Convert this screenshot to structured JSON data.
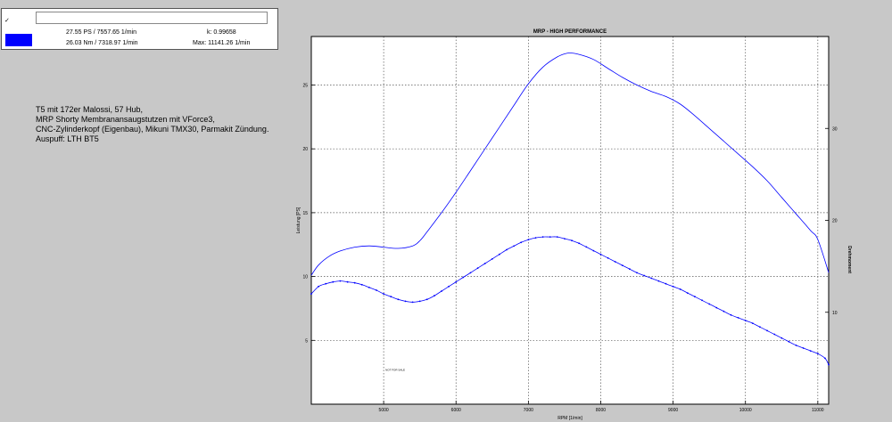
{
  "legend": {
    "checkbox_label": "✓",
    "color": "#0000ff",
    "row1_value": "27.55 PS / 7557.65 1/min",
    "row1_k": "k: 0.99658",
    "row2_value": "26.03 Nm / 7318.97 1/min",
    "row2_max": "Max: 11141.26 1/min"
  },
  "notes": {
    "lines": [
      "T5 mit 172er Malossi, 57 Hub,",
      "MRP Shorty Membranansaugstutzen mit VForce3,",
      "CNC-Zylinderkopf (Eigenbau), Mikuni TMX30, Parmakit Zündung.",
      "Auspuff: LTH BT5"
    ]
  },
  "chart_data": {
    "type": "line",
    "title": "MRP - HIGH PERFORMANCE",
    "xlabel": "RPM [1/min]",
    "ylabel": "Leistung [PS]",
    "y2label": "Drehmoment",
    "watermark": "NOT FOR SALE",
    "xlim": [
      4000,
      11150
    ],
    "ylim": [
      0,
      28.8
    ],
    "y2lim": [
      0,
      40
    ],
    "x_ticks": [
      5000,
      6000,
      7000,
      8000,
      9000,
      10000,
      11000
    ],
    "y_ticks": [
      5,
      10,
      15,
      20,
      25
    ],
    "y2_ticks": [
      10,
      20,
      30
    ],
    "grid": true,
    "line_color": "#0000ff",
    "series": [
      {
        "axis": "left",
        "markers": false,
        "x": [
          4000,
          4100,
          4250,
          4400,
          4600,
          4800,
          5000,
          5200,
          5400,
          5500,
          5600,
          5800,
          6000,
          6200,
          6400,
          6600,
          6800,
          7000,
          7200,
          7400,
          7550,
          7700,
          7900,
          8100,
          8300,
          8500,
          8700,
          8900,
          9100,
          9300,
          9500,
          9700,
          9900,
          10100,
          10300,
          10500,
          10700,
          10900,
          11000,
          11150
        ],
        "y": [
          10.1,
          10.9,
          11.6,
          12.0,
          12.3,
          12.4,
          12.3,
          12.2,
          12.4,
          12.8,
          13.5,
          15.0,
          16.6,
          18.3,
          20.0,
          21.7,
          23.4,
          25.1,
          26.4,
          27.2,
          27.5,
          27.4,
          27.0,
          26.3,
          25.6,
          25.0,
          24.5,
          24.1,
          23.5,
          22.6,
          21.6,
          20.6,
          19.6,
          18.6,
          17.5,
          16.2,
          14.9,
          13.6,
          12.9,
          10.3
        ]
      },
      {
        "axis": "right",
        "markers": true,
        "x": [
          4000,
          4100,
          4200,
          4300,
          4400,
          4500,
          4600,
          4700,
          4800,
          4900,
          5000,
          5100,
          5200,
          5300,
          5400,
          5500,
          5600,
          5700,
          5800,
          5900,
          6000,
          6100,
          6200,
          6300,
          6400,
          6500,
          6600,
          6700,
          6800,
          6900,
          7000,
          7100,
          7200,
          7300,
          7400,
          7500,
          7600,
          7700,
          7800,
          7900,
          8000,
          8100,
          8200,
          8300,
          8400,
          8500,
          8600,
          8700,
          8800,
          8900,
          9000,
          9100,
          9200,
          9300,
          9400,
          9500,
          9600,
          9700,
          9800,
          9900,
          10000,
          10100,
          10200,
          10300,
          10400,
          10500,
          10600,
          10700,
          10800,
          10900,
          11000,
          11100,
          11150
        ],
        "y": [
          12.0,
          12.8,
          13.1,
          13.3,
          13.4,
          13.3,
          13.2,
          13.0,
          12.7,
          12.4,
          12.0,
          11.7,
          11.4,
          11.2,
          11.1,
          11.2,
          11.4,
          11.8,
          12.3,
          12.8,
          13.3,
          13.8,
          14.3,
          14.8,
          15.3,
          15.8,
          16.3,
          16.8,
          17.2,
          17.6,
          17.9,
          18.1,
          18.2,
          18.2,
          18.2,
          18.0,
          17.8,
          17.5,
          17.1,
          16.7,
          16.3,
          15.9,
          15.5,
          15.1,
          14.7,
          14.3,
          14.0,
          13.7,
          13.4,
          13.1,
          12.8,
          12.5,
          12.1,
          11.7,
          11.3,
          10.9,
          10.5,
          10.1,
          9.7,
          9.4,
          9.1,
          8.8,
          8.4,
          8.0,
          7.6,
          7.2,
          6.8,
          6.4,
          6.1,
          5.8,
          5.5,
          5.0,
          4.3
        ]
      }
    ]
  }
}
